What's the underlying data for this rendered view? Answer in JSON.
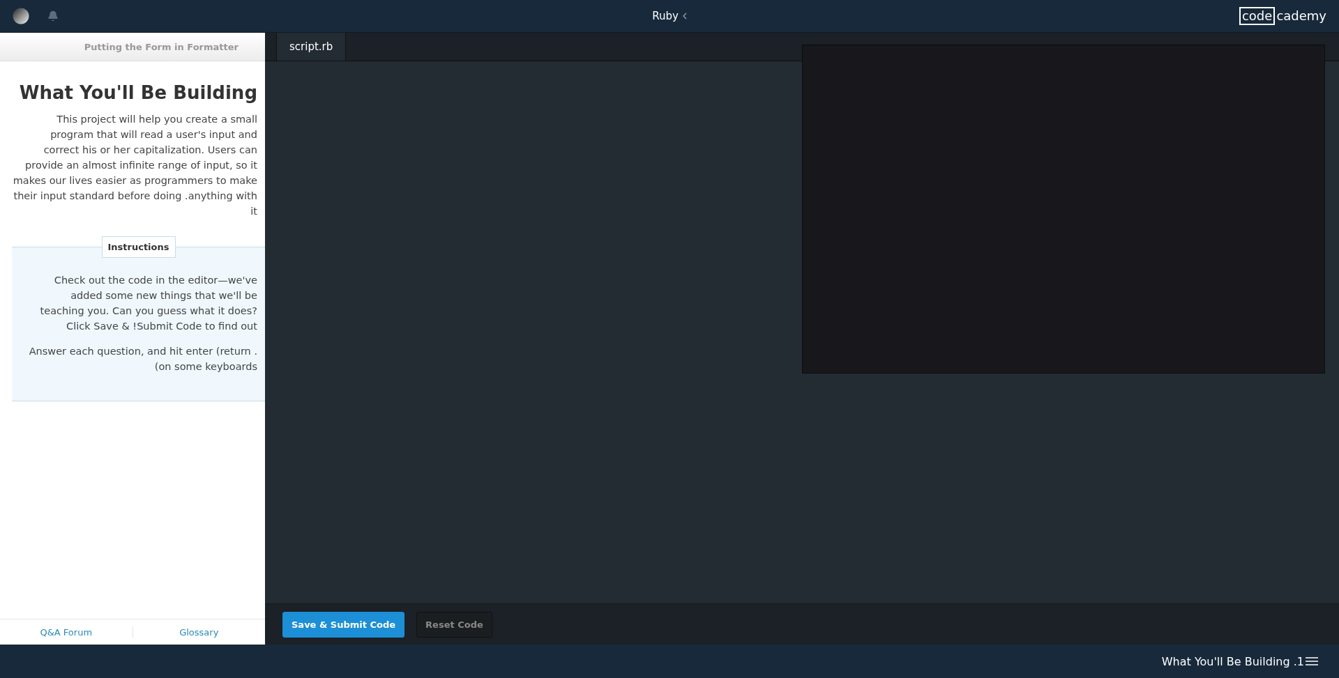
{
  "top_bar": {
    "course": "Ruby",
    "logo": {
      "boxed": "code",
      "rest": "cademy"
    }
  },
  "lesson_panel": {
    "header": "Putting the Form in Formatter",
    "title": "What You'll Be Building",
    "paragraphs": [
      "This project will help you create a small program that will read a user's input and correct his or her capitalization. Users can provide an almost infinite range of input, so it makes our lives easier as programmers to make their input standard before doing .anything with it"
    ],
    "instructions": {
      "label": "Instructions",
      "paragraphs": [
        "Check out the code in the editor—we've added some new things that we'll be teaching you. Can you guess what it does? Click Save & !Submit Code to find out",
        "Answer each question, and hit enter (return .(on some keyboards"
      ]
    },
    "footer_links": [
      "Q&A Forum",
      "Glossary"
    ]
  },
  "editor": {
    "tabs": [
      {
        "label": "script.rb",
        "selected": true
      }
    ],
    "buttons": [
      {
        "label": "Save & Submit Code",
        "kind": "primary"
      },
      {
        "label": "Reset Code",
        "kind": "secondary"
      }
    ]
  },
  "status_bar": {
    "lesson": "What You'll Be Building .1"
  }
}
